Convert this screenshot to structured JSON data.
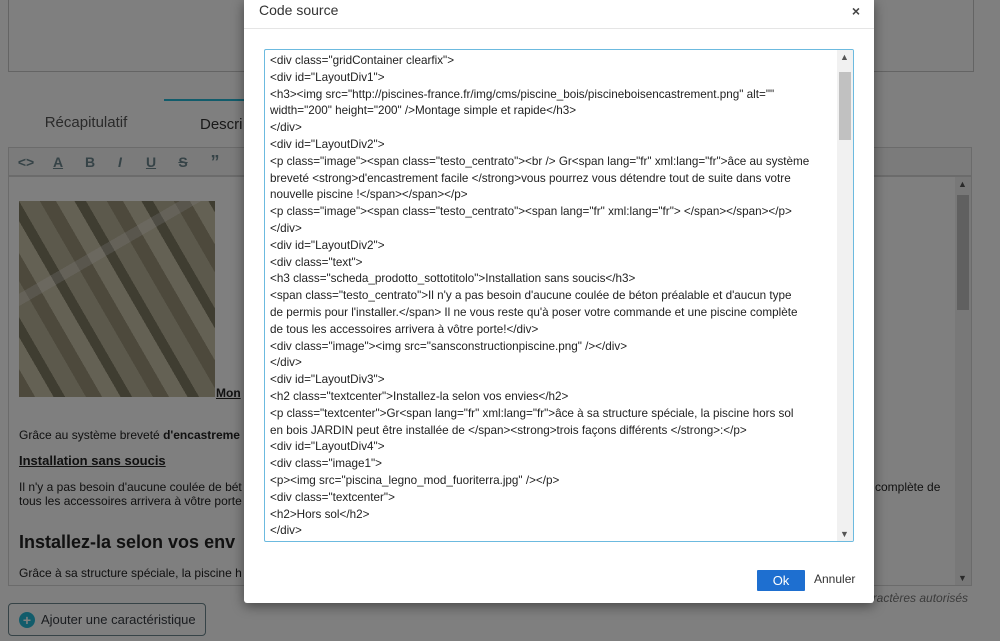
{
  "tabs": {
    "recap": "Récapitulatif",
    "description": "Descri"
  },
  "editor": {
    "heading_fragment": "Mon",
    "line1_a": "Grâce au système breveté ",
    "line1_b": "d'encastreme",
    "h3": "Installation sans soucis",
    "p1": "Il n'y a pas besoin d'aucune coulée de bét",
    "p1_right": "complète de",
    "p2": "tous les accessoires arrivera à vôtre porte",
    "h2": "Installez-la selon vos env",
    "p3": "Grâce à sa structure spéciale, la piscine h"
  },
  "chars_note": "aractères autorisés",
  "add_button": "Ajouter une caractéristique",
  "modal": {
    "title": "Code source",
    "close": "×",
    "ok": "Ok",
    "cancel": "Annuler",
    "code": [
      "<div class=\"gridContainer clearfix\">",
      "<div id=\"LayoutDiv1\">",
      "<h3><img src=\"http://piscines-france.fr/img/cms/piscine_bois/piscineboisencastrement.png\" alt=\"\"",
      "width=\"200\" height=\"200\" />Montage simple et rapide</h3>",
      "</div>",
      "<div id=\"LayoutDiv2\">",
      "<p class=\"image\"><span class=\"testo_centrato\"><br /> Gr<span lang=\"fr\" xml:lang=\"fr\">âce au système",
      "breveté <strong>d'encastrement facile </strong>vous pourrez vous détendre tout de suite dans votre",
      "nouvelle piscine !</span></span></p>",
      "<p class=\"image\"><span class=\"testo_centrato\"><span lang=\"fr\" xml:lang=\"fr\"> </span></span></p>",
      "</div>",
      "<div id=\"LayoutDiv2\">",
      "<div class=\"text\">",
      "<h3 class=\"scheda_prodotto_sottotitolo\">Installation sans soucis</h3>",
      "<span class=\"testo_centrato\">Il n'y a pas besoin d'aucune coulée de béton préalable et d'aucun type",
      "de permis pour l'installer.</span> Il ne vous reste qu'à poser votre commande et une piscine complète",
      "de tous les accessoires arrivera à vôtre porte!</div>",
      "<div class=\"image\"><img src=\"sansconstructionpiscine.png\" /></div>",
      "</div>",
      "<div id=\"LayoutDiv3\">",
      "<h2 class=\"textcenter\">Installez-la selon vos envies</h2>",
      "<p class=\"textcenter\">Gr<span lang=\"fr\" xml:lang=\"fr\">âce à sa structure spéciale, la piscine hors sol",
      "en bois JARDIN peut être installée de </span><strong>trois façons différents </strong>:</p>",
      "<div id=\"LayoutDiv4\">",
      "<div class=\"image1\">",
      "<p><img src=\"piscina_legno_mod_fuoriterra.jpg\" /></p>",
      "<div class=\"textcenter\">",
      "<h2>Hors sol</h2>",
      "</div>"
    ]
  }
}
